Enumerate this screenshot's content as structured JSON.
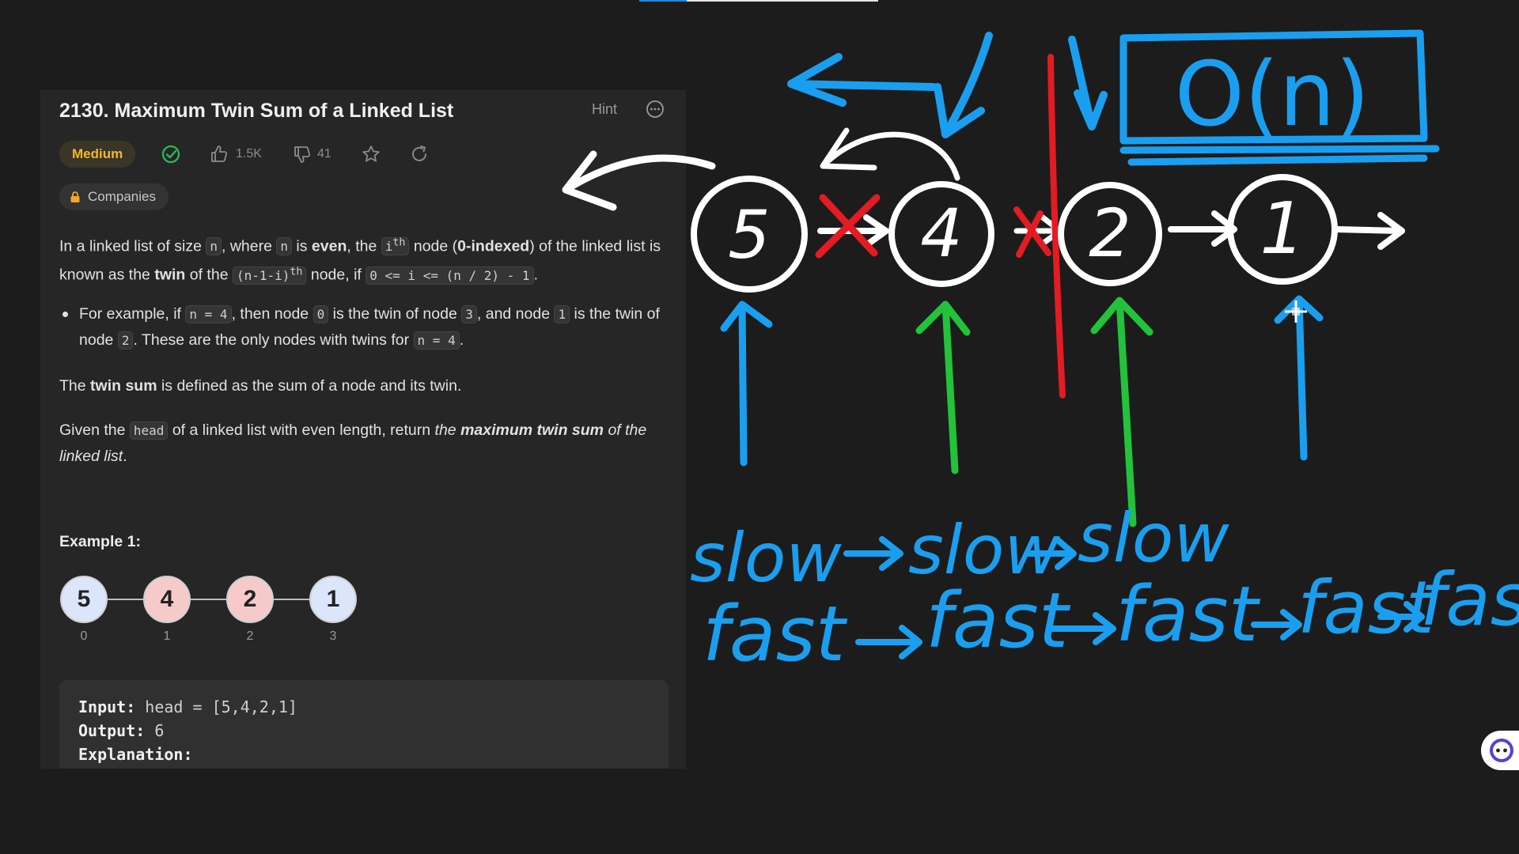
{
  "problem": {
    "title": "2130. Maximum Twin Sum of a Linked List",
    "hint_label": "Hint",
    "difficulty": "Medium",
    "likes": "1.5K",
    "dislikes": "41",
    "companies_label": "Companies",
    "colors": {
      "difficulty": "#f5b81f",
      "solved_check": "#2cbb5d"
    }
  },
  "description": {
    "p1": {
      "t1": "In a linked list of size ",
      "c1": "n",
      "t2": ", where ",
      "c2": "n",
      "t3": " is ",
      "b1": "even",
      "t4": ", the ",
      "c3": "i",
      "c3sup": "th",
      "t5": " node (",
      "b2": "0-indexed",
      "t6": ") of the linked list is known as the ",
      "b3": "twin",
      "t7": " of the ",
      "c4": "(n-1-i)",
      "c4sup": "th",
      "t8": " node, if ",
      "c5": "0 <= i <= (n / 2) - 1",
      "t9": "."
    },
    "bullet": {
      "t1": "For example, if ",
      "c1": "n = 4",
      "t2": ", then node ",
      "c2": "0",
      "t3": " is the twin of node ",
      "c3": "3",
      "t4": ", and node ",
      "c4": "1",
      "t5": " is the twin of node ",
      "c5": "2",
      "t6": ". These are the only nodes with twins for ",
      "c6": "n = 4",
      "t7": "."
    },
    "p2": {
      "t1": "The ",
      "b1": "twin sum",
      "t2": " is defined as the sum of a node and its twin."
    },
    "p3": {
      "t1": "Given the ",
      "c1": "head",
      "t2": " of a linked list with even length, return ",
      "i1": "the ",
      "bi": "maximum twin sum",
      "i2": " of the linked list",
      "t3": "."
    }
  },
  "example": {
    "title": "Example 1:",
    "nodes": [
      {
        "value": "5",
        "index": "0"
      },
      {
        "value": "4",
        "index": "1"
      },
      {
        "value": "2",
        "index": "2"
      },
      {
        "value": "1",
        "index": "3"
      }
    ],
    "input_label": "Input:",
    "input_value": " head = [5,4,2,1]",
    "output_label": "Output:",
    "output_value": " 6",
    "explanation_label": "Explanation:"
  },
  "whiteboard": {
    "nodes": [
      "5",
      "4",
      "2",
      "1"
    ],
    "complexity": "O(n)",
    "slow_label": "slow",
    "fast_label": "fast",
    "colors": {
      "white": "#ffffff",
      "blue": "#1a9ff0",
      "green": "#22c33a",
      "red": "#e31b23"
    }
  }
}
